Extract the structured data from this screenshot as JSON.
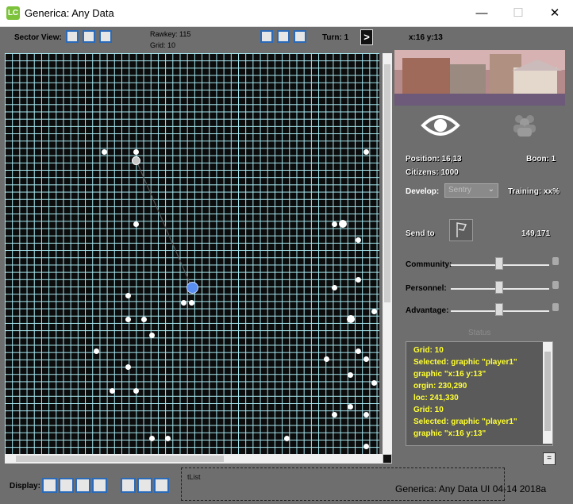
{
  "window": {
    "title": "Generica: Any Data",
    "app_icon_text": "LC",
    "minimize": "—",
    "maximize": "☐",
    "close": "✕"
  },
  "toolbar": {
    "sector_view_label": "Sector View:",
    "rawkey": "Rawkey: 115",
    "grid": "Grid: 10",
    "turn_label": "Turn: 1",
    "next_turn": ">",
    "coords": "x:16 y:13"
  },
  "info": {
    "position": "Position: 16,13",
    "boon": "Boon: 1",
    "citizens": "Citizens: 1000",
    "develop_label": "Develop:",
    "develop_value": "Sentry",
    "training": "Training: xx%",
    "send_to_label": "Send to",
    "send_to_value": "149,171",
    "icons": [
      "eye-icon",
      "group-icon",
      "flag-icon"
    ]
  },
  "sliders": [
    {
      "label": "Community:",
      "value": 0.5
    },
    {
      "label": "Personnel:",
      "value": 0.5
    },
    {
      "label": "Advantage:",
      "value": 0.5
    }
  ],
  "status": {
    "title": "Status",
    "lines": [
      "Grid: 10",
      "Selected: graphic \"player1\"",
      "graphic \"x:16 y:13\"",
      "orgin: 230,290",
      "loc: 241,330",
      "Grid: 10",
      "Selected: graphic \"player1\"",
      "graphic \"x:16 y:13\""
    ]
  },
  "bottom": {
    "display_label": "Display:",
    "tlist_label": "tList",
    "footer": "Generica: Any Data UI 04-14 2018a",
    "menu_button": "="
  },
  "colors": {
    "grid_line": "#a9ecf5",
    "selected_unit": "#5a8ef0",
    "status_text": "#ffff33",
    "panel_bg": "#6e6e6e"
  }
}
